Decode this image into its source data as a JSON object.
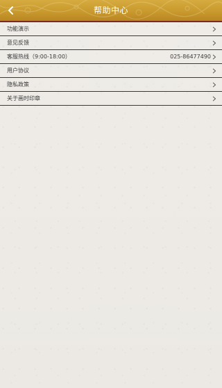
{
  "header": {
    "title": "帮助中心",
    "back_icon": "chevron-left-icon",
    "background": "#c99a2e",
    "border_color": "#7e2a1c"
  },
  "menu": {
    "items": [
      {
        "label": "功能演示",
        "value": ""
      },
      {
        "label": "意见反馈",
        "value": ""
      },
      {
        "label": "客服热线（9:00-18:00）",
        "value": "025-86477490"
      },
      {
        "label": "用户协议",
        "value": ""
      },
      {
        "label": "隐私政策",
        "value": ""
      },
      {
        "label": "关于画时印章",
        "value": ""
      }
    ],
    "chevron_icon": "chevron-right-icon",
    "divider_color": "#6e2318"
  }
}
